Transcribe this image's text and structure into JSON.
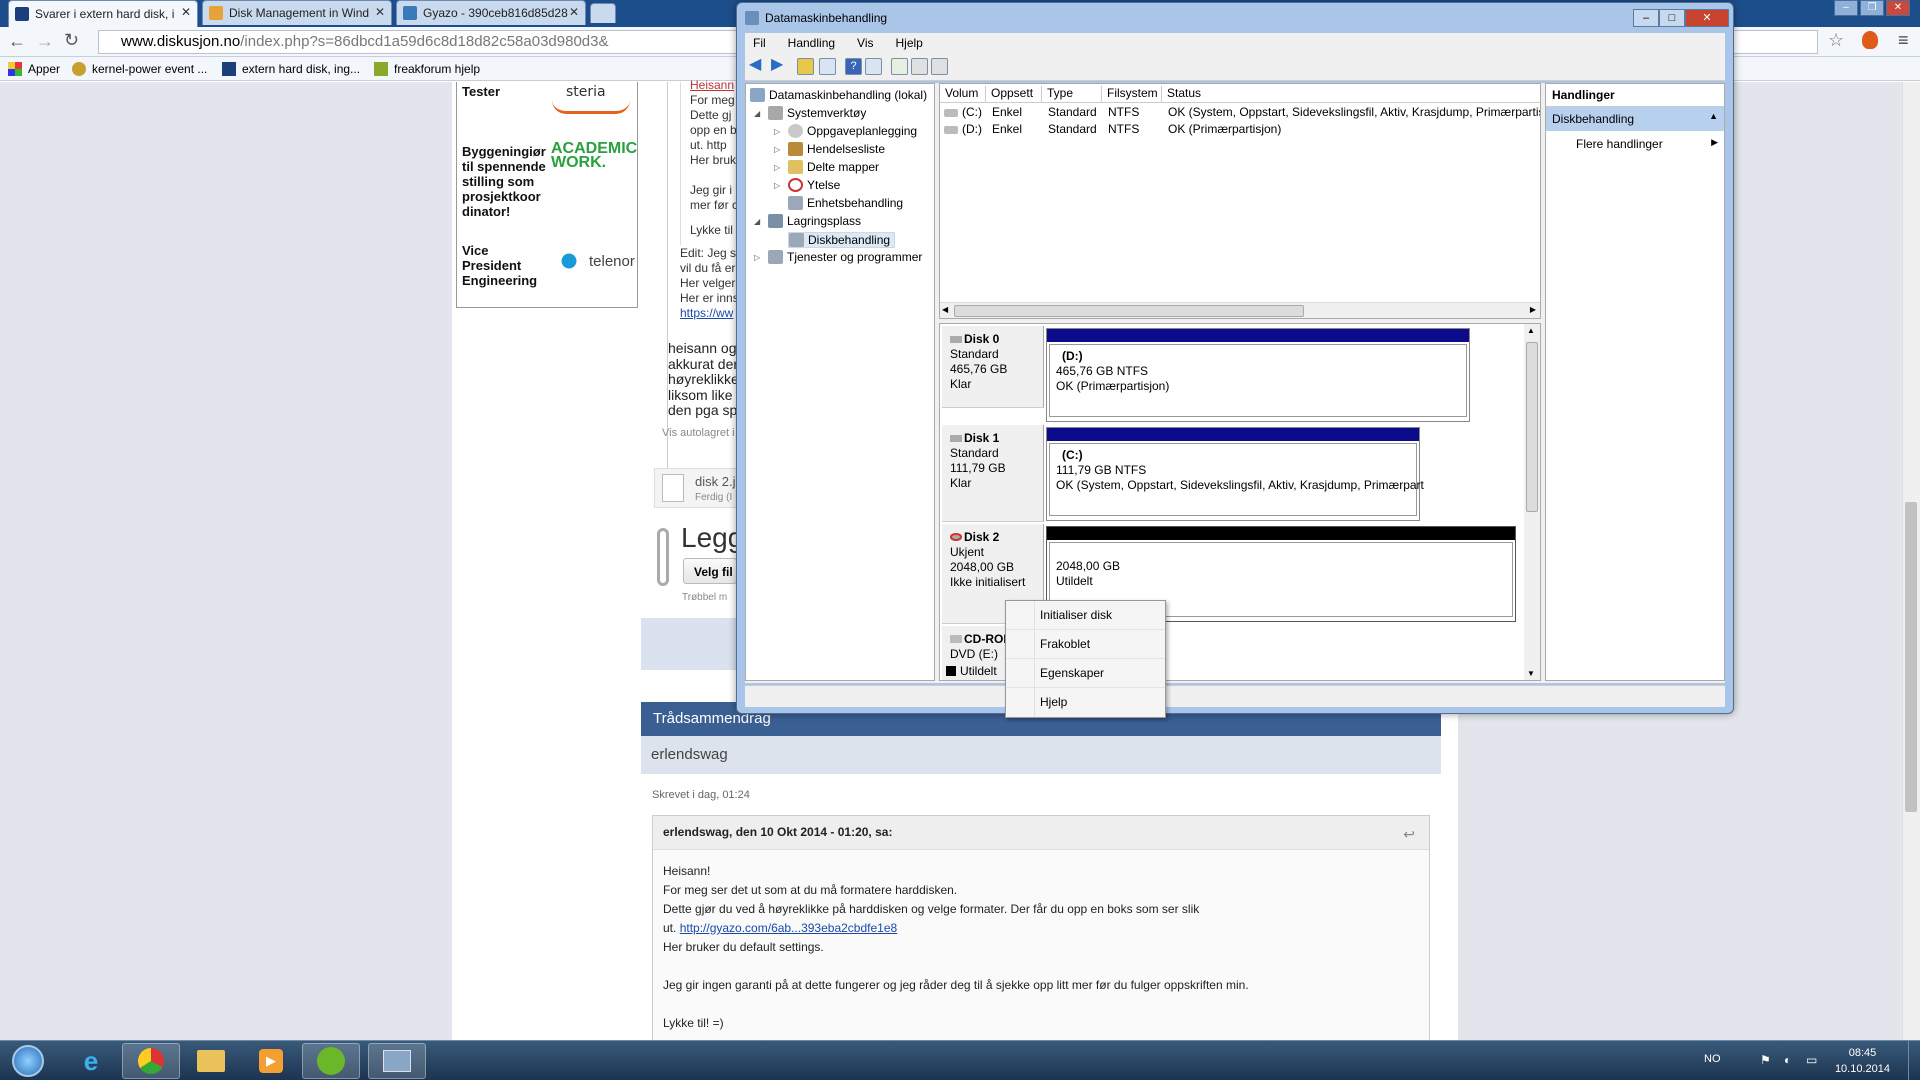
{
  "browser": {
    "tabs": [
      {
        "label": "Svarer i extern hard disk, i",
        "active": true
      },
      {
        "label": "Disk Management in Wind",
        "active": false
      },
      {
        "label": "Gyazo - 390ceb816d85d28",
        "active": false
      }
    ],
    "url_domain": "www.diskusjon.no",
    "url_rest": "/index.php?s=86dbcd1a59d6c8d18d82c58a03d980d3&",
    "bookmarks": [
      "Apper",
      "kernel-power event ...",
      "extern hard disk, ing...",
      "freakforum hjelp"
    ]
  },
  "forum": {
    "ads": [
      {
        "text": "Tester",
        "logo": "steria"
      },
      {
        "text": "Byggeningiør til spennende stilling som prosjektkoor dinator!",
        "logo": "ACADEMIC WORK."
      },
      {
        "text": "Vice President Engineering",
        "logo": "telenor"
      }
    ],
    "fragments": {
      "q1": "Heisann",
      "q2": "For meg",
      "q3": "Dette gj",
      "q4": "opp en b",
      "q5": "ut. http",
      "q6": "Her bruk",
      "q7": "Jeg gir i",
      "q8": "mer før c",
      "q9": "Lykke til",
      "e1": "Edit: Jeg s",
      "e2": "vil du få er",
      "e3": "Her velger",
      "e4": "Her er inns",
      "e5": "https://ww",
      "r1": "heisann og",
      "r2": "akkurat der",
      "r3": "høyreklikke",
      "r4": "liksom like",
      "r5": "den pga sp",
      "autosave": "Vis autolagret i",
      "attach_name": "disk 2.j",
      "attach_status": "Ferdig (I",
      "legg": "Legg",
      "velg": "Velg fil",
      "trouble": "Trøbbel m"
    },
    "summary_title": "Trådsammendrag",
    "summary_user": "erlendswag",
    "written": "Skrevet i dag, 01:24",
    "quote_head": "erlendswag, den 10 Okt 2014 - 01:20, sa:",
    "quote_lines": [
      "Heisann!",
      "For meg ser det ut som at du må formatere harddisken.",
      "Dette gjør du ved å høyreklikke på harddisken og velge formater. Der får du opp en boks som ser slik",
      "Her bruker du default settings.",
      "Jeg gir ingen garanti på at dette fungerer og jeg råder deg til å sjekke opp litt mer før du fulger oppskriften min.",
      "Lykke til! =)"
    ],
    "quote_link_prefix": "ut. ",
    "quote_link": "http://gyazo.com/6ab...393eba2cbdfe1e8"
  },
  "diskmgmt": {
    "title": "Datamaskinbehandling",
    "menu": [
      "Fil",
      "Handling",
      "Vis",
      "Hjelp"
    ],
    "tree": {
      "root": "Datamaskinbehandling (lokal)",
      "system": "Systemverktøy",
      "task": "Oppgaveplanlegging",
      "events": "Hendelsesliste",
      "shared": "Delte mapper",
      "perf": "Ytelse",
      "devices": "Enhetsbehandling",
      "storage": "Lagringsplass",
      "disk": "Diskbehandling",
      "services": "Tjenester og programmer"
    },
    "columns": [
      "Volum",
      "Oppsett",
      "Type",
      "Filsystem",
      "Status"
    ],
    "volumes": [
      {
        "vol": "(C:)",
        "layout": "Enkel",
        "type": "Standard",
        "fs": "NTFS",
        "status": "OK (System, Oppstart, Sidevekslingsfil, Aktiv, Krasjdump, Primærpartis"
      },
      {
        "vol": "(D:)",
        "layout": "Enkel",
        "type": "Standard",
        "fs": "NTFS",
        "status": "OK (Primærpartisjon)"
      }
    ],
    "disks": [
      {
        "name": "Disk 0",
        "type": "Standard",
        "size": "465,76 GB",
        "state": "Klar",
        "part_title": "(D:)",
        "part_size": "465,76 GB NTFS",
        "part_status": "OK (Primærpartisjon)"
      },
      {
        "name": "Disk 1",
        "type": "Standard",
        "size": "111,79 GB",
        "state": "Klar",
        "part_title": "(C:)",
        "part_size": "111,79 GB NTFS",
        "part_status": "OK (System, Oppstart, Sidevekslingsfil, Aktiv, Krasjdump, Primærpart"
      },
      {
        "name": "Disk 2",
        "type": "Ukjent",
        "size": "2048,00 GB",
        "state": "Ikke initialisert",
        "part_size": "2048,00 GB",
        "part_status": "Utildelt"
      }
    ],
    "cdrom": {
      "name": "CD-ROM",
      "drive": "DVD (E:)",
      "legend": "Utildelt"
    },
    "actions_title": "Handlinger",
    "actions_selected": "Diskbehandling",
    "actions_more": "Flere handlinger",
    "context_menu": [
      "Initialiser disk",
      "Frakoblet",
      "Egenskaper",
      "Hjelp"
    ]
  },
  "taskbar": {
    "lang": "NO",
    "time": "08:45",
    "date": "10.10.2014"
  }
}
